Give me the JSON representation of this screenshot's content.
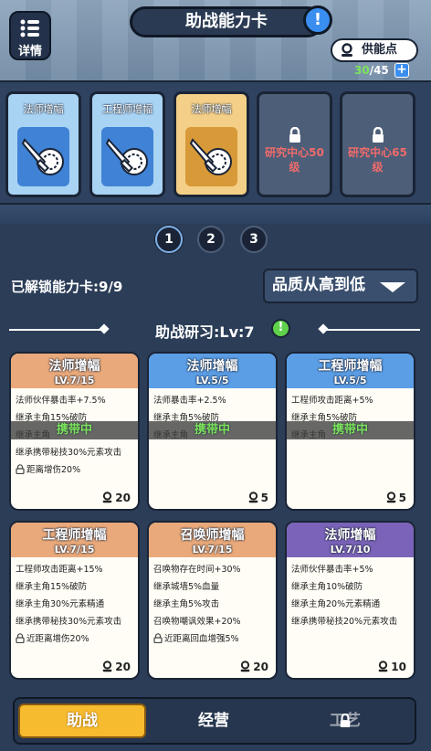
{
  "header": {
    "details_label": "详情",
    "title": "助战能力卡",
    "help_icon": "!",
    "supply_label": "供能点",
    "supply_current": "30",
    "supply_total": "/45",
    "plus_icon": "+"
  },
  "slots": [
    {
      "title": "法师增幅",
      "style": "blue"
    },
    {
      "title": "工程师增幅",
      "style": "blue"
    },
    {
      "title": "法师增幅",
      "style": "gold"
    },
    {
      "locked_text": "研究中心50级",
      "style": "locked"
    },
    {
      "locked_text": "研究中心65级",
      "style": "locked"
    }
  ],
  "pages": [
    "1",
    "2",
    "3"
  ],
  "active_page": "1",
  "unlocked_text": "已解锁能力卡:9/9",
  "sort_label": "品质从高到低",
  "section": {
    "title": "助战研习:Lv:7",
    "info_icon": "!"
  },
  "cards": [
    {
      "name": "法师增幅",
      "level": "LV.7/15",
      "color": "orange",
      "cost": "20",
      "lines": [
        "法师伙伴暴击率+7.5%",
        "继承主角15%破防",
        "继承主角",
        "继承携带秘技30%元素攻击"
      ],
      "locked_line": "距离增伤20%",
      "carry": "携带中"
    },
    {
      "name": "法师增幅",
      "level": "LV.5/5",
      "color": "blue",
      "cost": "5",
      "lines": [
        "法师暴击率+2.5%",
        "继承主角5%破防",
        "继承主角"
      ],
      "locked_line": "",
      "carry": "携带中"
    },
    {
      "name": "工程师增幅",
      "level": "LV.5/5",
      "color": "blue",
      "cost": "5",
      "lines": [
        "工程师攻击距离+5%",
        "继承主角5%破防",
        "继承主角"
      ],
      "locked_line": "",
      "carry": "携带中"
    },
    {
      "name": "工程师增幅",
      "level": "LV.7/15",
      "color": "orange",
      "cost": "20",
      "lines": [
        "工程师攻击距离+15%",
        "继承主角15%破防",
        "继承主角30%元素精通",
        "继承携带秘技30%元素攻击"
      ],
      "locked_line": "近距离增伤20%",
      "carry": ""
    },
    {
      "name": "召唤师增幅",
      "level": "LV.7/15",
      "color": "orange",
      "cost": "20",
      "lines": [
        "召唤物存在时间+30%",
        "继承城墙5%血量",
        "继承主角5%攻击",
        "召唤物嘲讽效果+20%"
      ],
      "locked_line": "近距离回血增强5%",
      "carry": ""
    },
    {
      "name": "法师增幅",
      "level": "LV.7/10",
      "color": "purple",
      "cost": "10",
      "lines": [
        "法师伙伴暴击率+5%",
        "继承主角10%破防",
        "继承主角20%元素精通",
        "继承携带秘技20%元素攻击"
      ],
      "locked_line": "",
      "carry": ""
    }
  ],
  "tabs": [
    {
      "label": "助战",
      "active": true
    },
    {
      "label": "经营",
      "active": false
    },
    {
      "label": "工艺",
      "active": false,
      "locked": true
    }
  ],
  "colors": {
    "accent_gold": "#f6bb2e",
    "carry_green": "#7be35a",
    "locked_red": "#f06b6b"
  }
}
